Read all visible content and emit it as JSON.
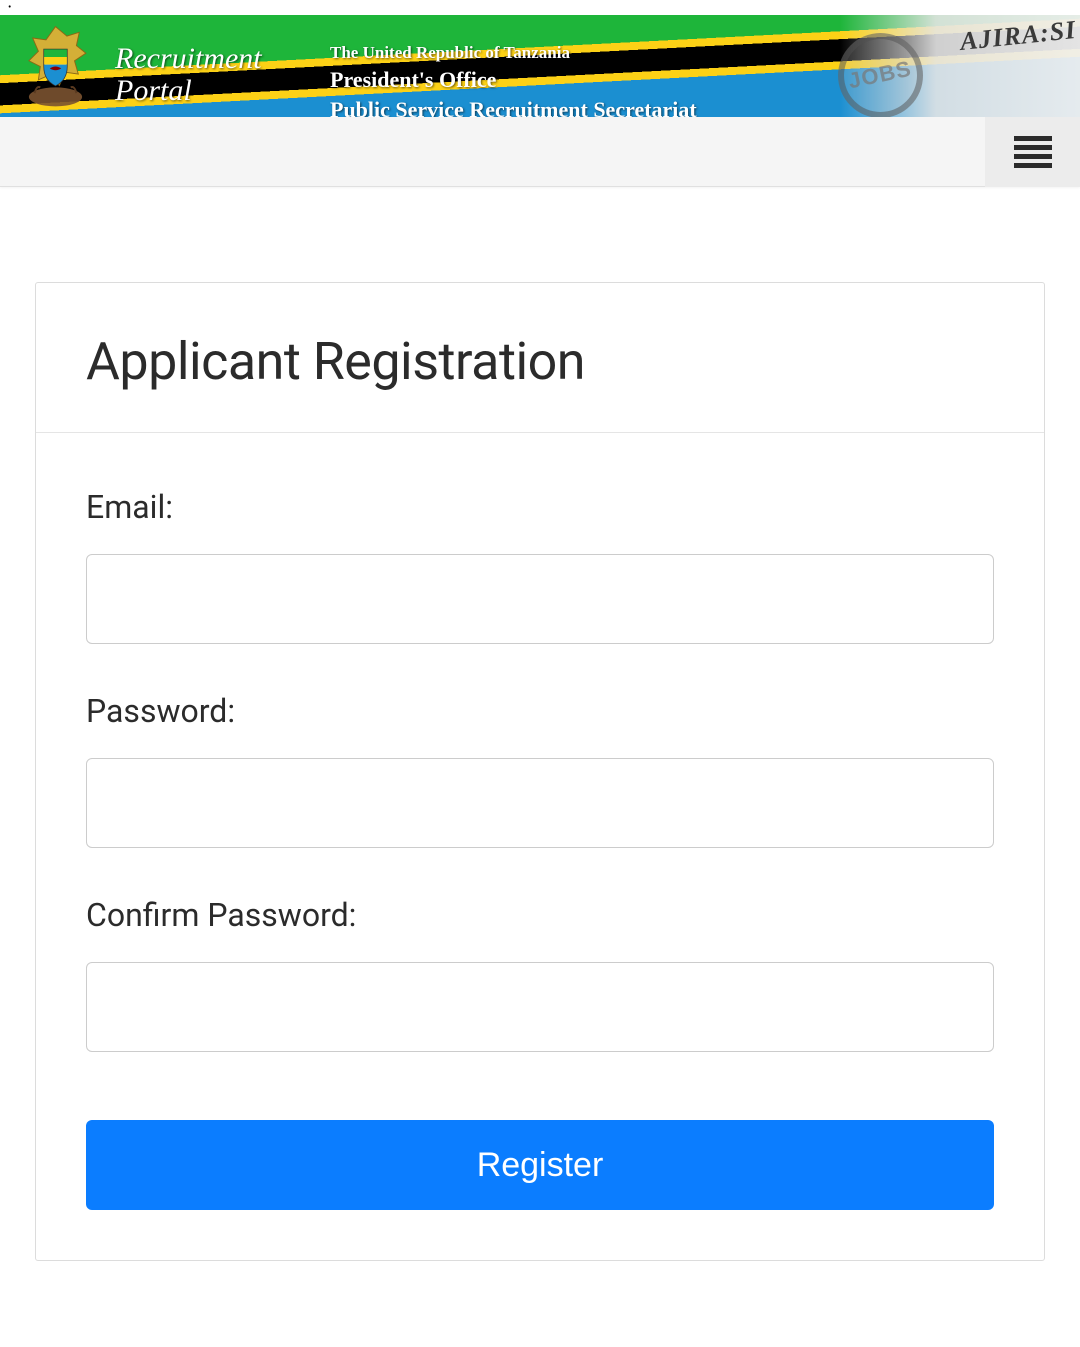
{
  "banner": {
    "portal_name_line1": "Recruitment",
    "portal_name_line2": "Portal",
    "country_line": "The United Republic of Tanzania",
    "office_line": "President's Office",
    "secretariat_line": "Public Service Recruitment Secretariat",
    "ajira_text": "AJIRA:SI",
    "jobs_text": "JOBS"
  },
  "form": {
    "title": "Applicant Registration",
    "email_label": "Email:",
    "email_value": "",
    "password_label": "Password:",
    "password_value": "",
    "confirm_password_label": "Confirm Password:",
    "confirm_password_value": "",
    "register_button": "Register"
  }
}
